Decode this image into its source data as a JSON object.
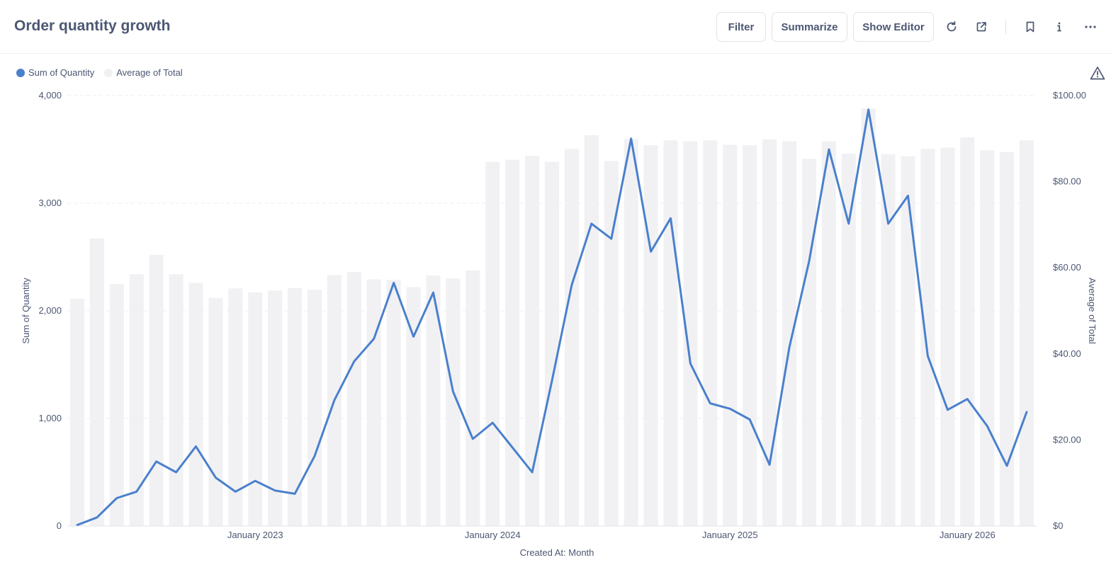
{
  "header": {
    "title": "Order quantity growth",
    "filter_label": "Filter",
    "summarize_label": "Summarize",
    "show_editor_label": "Show Editor"
  },
  "icons": {
    "refresh": "refresh-icon",
    "share": "share-icon",
    "bookmark": "bookmark-icon",
    "info": "info-icon",
    "more": "more-icon",
    "warning": "warning-icon"
  },
  "colors": {
    "line": "#4a80cc",
    "bar": "#f1f1f4",
    "text": "#4c5773",
    "grid": "#eceef1"
  },
  "chart_data": {
    "type": "bar",
    "xlabel": "Created At: Month",
    "ylabel_left": "Sum of Quantity",
    "ylabel_right": "Average of Total",
    "x_tick_labels": [
      "January 2023",
      "January 2024",
      "January 2025",
      "January 2026"
    ],
    "y_left_ticks": [
      "0",
      "1,000",
      "2,000",
      "3,000",
      "4,000"
    ],
    "y_right_ticks": [
      "$0",
      "$20.00",
      "$40.00",
      "$60.00",
      "$80.00",
      "$100.00"
    ],
    "ylim_left": [
      0,
      4000
    ],
    "ylim_right": [
      0,
      100
    ],
    "legend_position": "top-left",
    "grid": true,
    "months": [
      "2022-04",
      "2022-05",
      "2022-06",
      "2022-07",
      "2022-08",
      "2022-09",
      "2022-10",
      "2022-11",
      "2022-12",
      "2023-01",
      "2023-02",
      "2023-03",
      "2023-04",
      "2023-05",
      "2023-06",
      "2023-07",
      "2023-08",
      "2023-09",
      "2023-10",
      "2023-11",
      "2023-12",
      "2024-01",
      "2024-02",
      "2024-03",
      "2024-04",
      "2024-05",
      "2024-06",
      "2024-07",
      "2024-08",
      "2024-09",
      "2024-10",
      "2024-11",
      "2024-12",
      "2025-01",
      "2025-02",
      "2025-03",
      "2025-04",
      "2025-05",
      "2025-06",
      "2025-07",
      "2025-08",
      "2025-09",
      "2025-10",
      "2025-11",
      "2025-12",
      "2026-01",
      "2026-02",
      "2026-03",
      "2026-04"
    ],
    "series": [
      {
        "name": "Sum of Quantity",
        "type": "line",
        "axis": "left",
        "values": [
          10,
          80,
          260,
          320,
          600,
          500,
          740,
          450,
          320,
          420,
          330,
          300,
          650,
          1170,
          1530,
          1740,
          2260,
          1760,
          2170,
          1250,
          810,
          960,
          730,
          500,
          1350,
          2240,
          2810,
          2670,
          3600,
          2550,
          2860,
          1510,
          1140,
          1090,
          990,
          570,
          1660,
          2460,
          3500,
          2810,
          3870,
          2810,
          3070,
          1580,
          1080,
          1180,
          930,
          560,
          1060
        ]
      },
      {
        "name": "Average of Total",
        "type": "bar",
        "axis": "right",
        "values": [
          52.8,
          66.8,
          56.2,
          58.5,
          63.0,
          58.5,
          56.5,
          53.0,
          55.2,
          54.3,
          54.7,
          55.3,
          54.9,
          58.3,
          59.0,
          57.3,
          57.2,
          55.5,
          58.2,
          57.5,
          59.4,
          84.6,
          85.1,
          86.0,
          84.6,
          87.6,
          90.8,
          84.8,
          89.9,
          88.5,
          89.6,
          89.4,
          89.6,
          88.6,
          88.5,
          89.8,
          89.4,
          85.3,
          89.4,
          86.5,
          97.0,
          86.4,
          85.9,
          87.6,
          87.9,
          90.3,
          87.3,
          86.9,
          89.6
        ]
      }
    ]
  }
}
